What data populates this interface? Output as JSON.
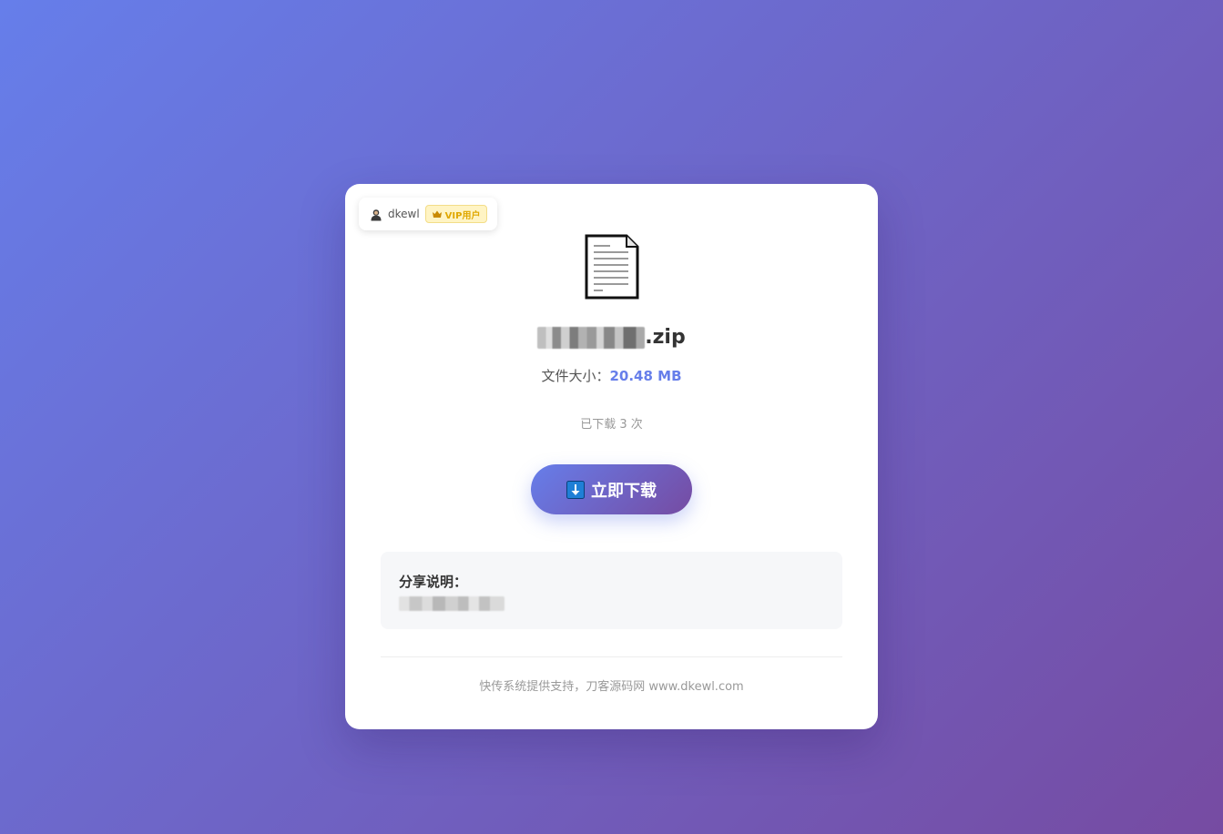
{
  "user": {
    "name": "dkewl",
    "vip_label": "VIP用户"
  },
  "file": {
    "extension": ".zip",
    "size_label": "文件大小：",
    "size_value": "20.48 MB",
    "download_count": "已下载 3 次"
  },
  "download_button": {
    "label": "立即下载"
  },
  "description": {
    "label": "分享说明："
  },
  "footer": {
    "text": "快传系统提供支持，刀客源码网 www.dkewl.com"
  },
  "colors": {
    "accent": "#667eea",
    "gradient_end": "#764ba2",
    "vip": "#e0a800"
  },
  "icons": {
    "user": "user-icon",
    "vip": "crown-icon",
    "file": "file-document-icon",
    "download": "download-arrow-icon"
  }
}
